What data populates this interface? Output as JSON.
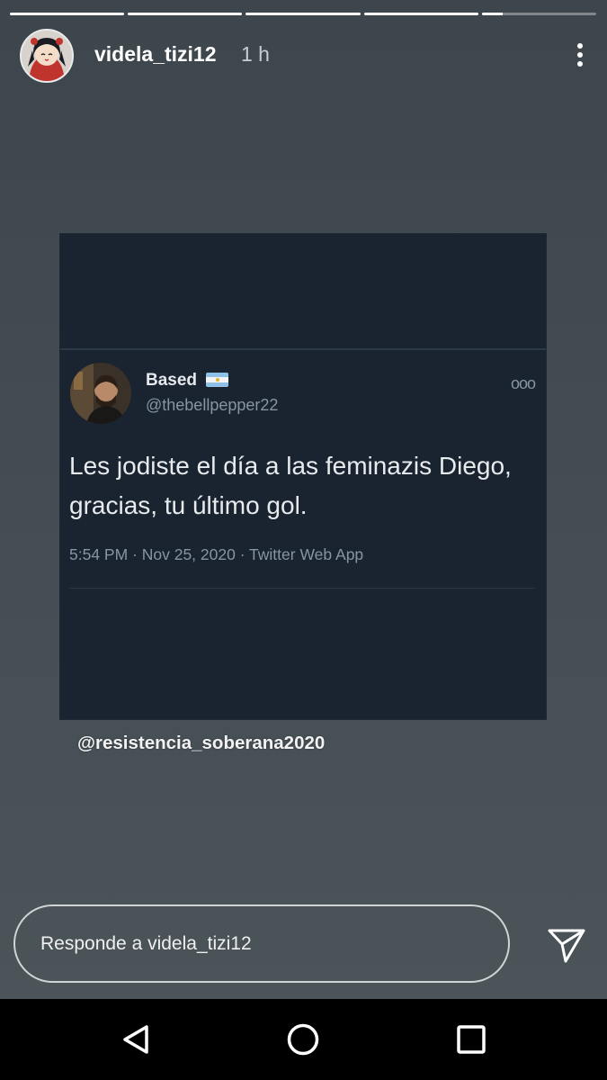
{
  "story": {
    "progress": [
      1,
      1,
      1,
      1,
      0.18
    ],
    "username": "videla_tizi12",
    "time": "1 h",
    "tweet": {
      "name": "Based",
      "handle": "@thebellpepper22",
      "text": "Les jodiste el día a las feminazis Diego, gracias, tu último gol.",
      "meta": "5:54 PM · Nov 25, 2020 · Twitter Web App",
      "more": "ooo"
    },
    "watermark": "@resistencia_soberana2020",
    "reply_placeholder": "Responde a videla_tizi12"
  },
  "icons": {
    "more": "more-vertical-icon",
    "send": "send-icon",
    "back": "nav-back-icon",
    "home": "nav-home-icon",
    "recents": "nav-recents-icon"
  },
  "colors": {
    "story_bg": "#3d464c",
    "tweet_bg": "#1a2431",
    "flag_blue": "#8fc1e8"
  }
}
